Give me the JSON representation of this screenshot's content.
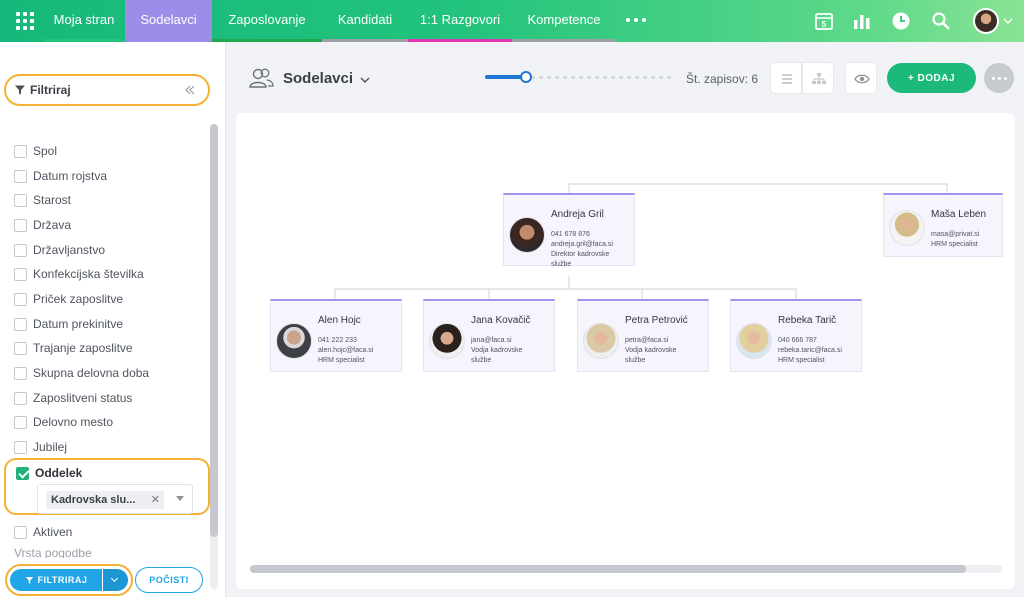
{
  "nav": {
    "tabs": [
      {
        "label": "Moja stran",
        "color": "#22c37c"
      },
      {
        "label": "Sodelavci",
        "color": "#9b8ee9"
      },
      {
        "label": "Zaposlovanje",
        "color": "#1fa84c"
      },
      {
        "label": "Kandidati",
        "color": "#9aa0a6"
      },
      {
        "label": "1:1 Razgovori",
        "color": "#e236b6"
      },
      {
        "label": "Kompetence",
        "color": "#9aa0a6"
      }
    ],
    "calendar_day": "5"
  },
  "filter_panel": {
    "title": "Filtriraj",
    "fields": [
      "Spol",
      "Datum rojstva",
      "Starost",
      "Država",
      "Državljanstvo",
      "Konfekcijska številka",
      "Priček zaposlitve",
      "Datum prekinitve",
      "Trajanje zaposlitve",
      "Skupna delovna doba",
      "Zaposlitveni status",
      "Delovno mesto",
      "Jubilej"
    ],
    "oddelek": {
      "label": "Oddelek",
      "checked": true,
      "selected_value": "Kadrovska slu..."
    },
    "after_fields": [
      "Aktiven"
    ],
    "faded_field": "Vrsta pogodbe",
    "apply_label": "FILTRIRAJ",
    "reset_label": "POČISTI"
  },
  "main": {
    "title": "Sodelavci",
    "record_count": "Št. zapisov: 6",
    "add_label": "+ DODAJ"
  },
  "org_chart": {
    "people": [
      {
        "name": "Andreja Gril",
        "lines": [
          "041 678 876",
          "andreja.gril@faca.si",
          "Direktor kadrovske",
          "službe"
        ]
      },
      {
        "name": "Maša Leben",
        "lines": [
          "masa@privat.si",
          "HRM specialist"
        ]
      },
      {
        "name": "Alen Hojc",
        "lines": [
          "041 222 233",
          "alen.hojc@faca.si",
          "HRM specialist"
        ]
      },
      {
        "name": "Jana Kovačič",
        "lines": [
          "jana@faca.si",
          "Vodja kadrovske",
          "službe"
        ]
      },
      {
        "name": "Petra Petrović",
        "lines": [
          "petra@faca.si",
          "Vodja kadrovske",
          "službe"
        ]
      },
      {
        "name": "Rebeka Tarič",
        "lines": [
          "040 666 787",
          "rebeka.taric@faca.si",
          "HRM specialist"
        ]
      }
    ]
  }
}
